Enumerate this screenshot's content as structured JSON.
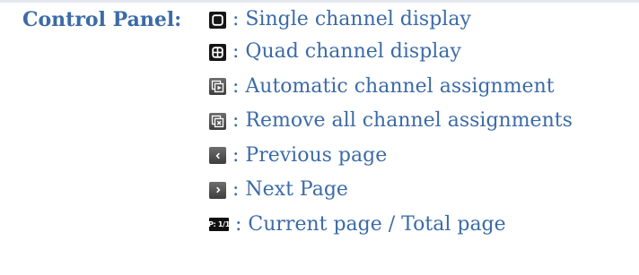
{
  "panel": {
    "title": "Control Panel:",
    "items": [
      {
        "icon": "single-channel-icon",
        "label": ": Single channel display"
      },
      {
        "icon": "quad-channel-icon",
        "label": ": Quad channel display"
      },
      {
        "icon": "auto-assign-icon",
        "label": ": Automatic channel assignment"
      },
      {
        "icon": "remove-assign-icon",
        "label": ": Remove all channel assignments"
      },
      {
        "icon": "previous-page-icon",
        "label": ": Previous page"
      },
      {
        "icon": "next-page-icon",
        "label": ": Next Page"
      },
      {
        "icon": "page-indicator-icon",
        "icon_text": "P: 1/1",
        "label": ": Current page / Total page"
      }
    ]
  }
}
